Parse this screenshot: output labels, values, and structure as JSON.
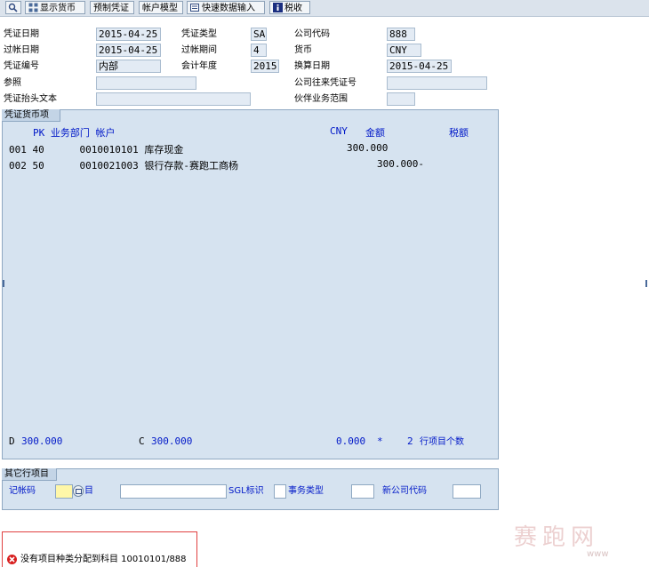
{
  "toolbar": {
    "buttons": [
      {
        "label": ""
      },
      {
        "label": "显示货币"
      },
      {
        "label": "预制凭证"
      },
      {
        "label": "帐户模型"
      },
      {
        "label": "快速数据输入"
      },
      {
        "label": "税收"
      }
    ]
  },
  "header": {
    "doc_date_label": "凭证日期",
    "doc_date": "2015-04-25",
    "doc_type_label": "凭证类型",
    "doc_type": "SA",
    "company_code_label": "公司代码",
    "company_code": "888",
    "posting_date_label": "过帐日期",
    "posting_date": "2015-04-25",
    "period_label": "过帐期间",
    "period": "4",
    "currency_label": "货币",
    "currency": "CNY",
    "doc_number_label": "凭证编号",
    "doc_number": "内部",
    "fiscal_year_label": "会计年度",
    "fiscal_year": "2015",
    "translation_date_label": "换算日期",
    "translation_date": "2015-04-25",
    "reference_label": "参照",
    "reference": "",
    "intercompany_label": "公司往来凭证号",
    "intercompany": "",
    "header_text_label": "凭证抬头文本",
    "header_text": "",
    "partner_area_label": "伙伴业务范围",
    "partner_area": ""
  },
  "items_panel": {
    "tab_label": "凭证货币项",
    "columns": {
      "pk_dept_account": "PK 业务部门 帐户",
      "cny": "CNY",
      "amount": "金额",
      "tax": "税额"
    },
    "rows": [
      {
        "line": "001 40      0010010101 库存现金",
        "amount": "300.000"
      },
      {
        "line": "002 50      0010021003 银行存款-赛跑工商杨",
        "amount": "300.000-"
      }
    ],
    "debit_label": "D",
    "debit_total": "300.000",
    "credit_label": "C",
    "credit_total": "300.000",
    "balance": "0.000",
    "balance_flag": "*",
    "item_count": "2",
    "item_count_label": "行项目个数"
  },
  "other_panel": {
    "tab_label": "其它行项目",
    "posting_key_label": "记帐码",
    "account_label": "目",
    "sgl_label": "SGL标识",
    "transaction_type_label": "事务类型",
    "new_company_label": "新公司代码"
  },
  "status": {
    "message": "没有项目种类分配到科目 10010101/888"
  },
  "watermark": {
    "text": "赛跑网",
    "sub": "www"
  }
}
